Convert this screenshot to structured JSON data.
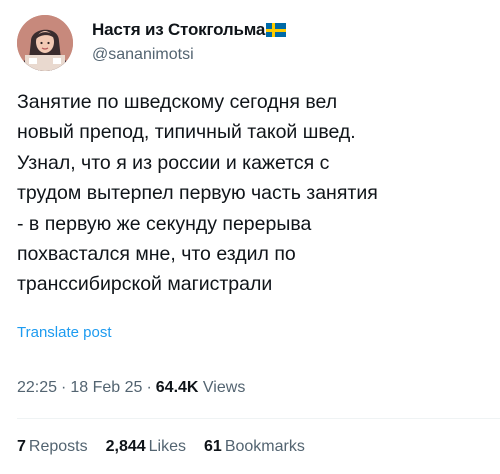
{
  "author": {
    "name": "Настя из Стокгольма",
    "flag_icon": "sweden-flag-icon",
    "handle": "@sananimotsi",
    "avatar_icon": "profile-avatar-illustration"
  },
  "tweet": {
    "lines": [
      "Занятие по шведскому сегодня вел",
      "новый препод, типичный такой швед.",
      "Узнал, что я из россии и кажется с",
      "трудом вытерпел первую часть занятия",
      "- в первую же секунду перерыва",
      "похвастался мне, что ездил по",
      "транссибирской магистрали"
    ],
    "translate_label": "Translate post"
  },
  "meta": {
    "time": "22:25",
    "separator": "·",
    "date": "18 Feb 25",
    "views_count": "64.4K",
    "views_label": "Views"
  },
  "stats": {
    "reposts_count": "7",
    "reposts_label": "Reposts",
    "likes_count": "2,844",
    "likes_label": "Likes",
    "bookmarks_count": "61",
    "bookmarks_label": "Bookmarks"
  },
  "colors": {
    "text": "#0f1419",
    "secondary": "#536471",
    "link": "#1d9bf0",
    "divider": "#eff3f4"
  }
}
